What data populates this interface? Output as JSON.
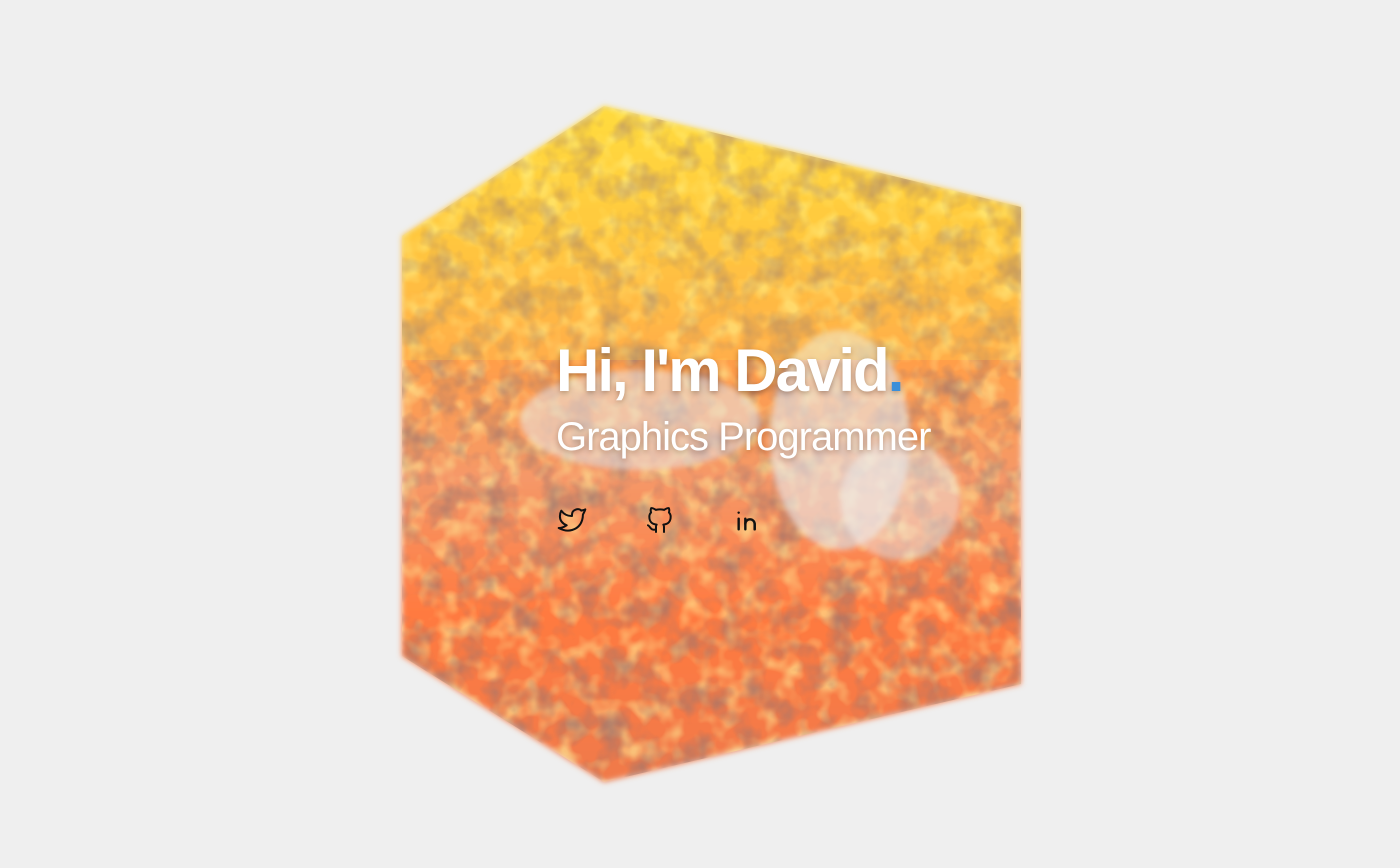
{
  "hero": {
    "title": "Hi, I'm David",
    "title_dot": ".",
    "subtitle": "Graphics Programmer",
    "accent_color": "#3b8fd9"
  },
  "socials": [
    {
      "icon": "twitter-icon",
      "label": "Twitter"
    },
    {
      "icon": "github-icon",
      "label": "GitHub"
    },
    {
      "icon": "linkedin-icon",
      "label": "LinkedIn"
    }
  ],
  "colors": {
    "background": "#efefef",
    "cube_hot": "#ffe94a",
    "cube_mid": "#ff8a3a",
    "cube_dark": "#5a3a3a",
    "text": "#ffffff",
    "icon": "#111111"
  }
}
